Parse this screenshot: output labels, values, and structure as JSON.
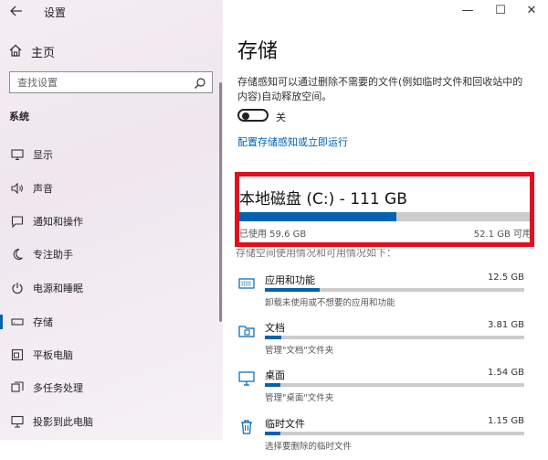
{
  "window": {
    "title": "设置",
    "minimize_glyph": "—",
    "maximize_glyph": "☐",
    "close_glyph": "✕"
  },
  "sidebar": {
    "home_label": "主页",
    "search_placeholder": "查找设置",
    "section_label": "系统",
    "items": [
      {
        "label": "显示",
        "icon": "monitor-icon"
      },
      {
        "label": "声音",
        "icon": "speaker-icon"
      },
      {
        "label": "通知和操作",
        "icon": "notification-icon"
      },
      {
        "label": "专注助手",
        "icon": "moon-icon"
      },
      {
        "label": "电源和睡眠",
        "icon": "power-icon"
      },
      {
        "label": "存储",
        "icon": "storage-icon",
        "active": true
      },
      {
        "label": "平板电脑",
        "icon": "tablet-icon"
      },
      {
        "label": "多任务处理",
        "icon": "multitask-icon"
      },
      {
        "label": "投影到此电脑",
        "icon": "project-icon"
      }
    ]
  },
  "main": {
    "title": "存储",
    "description": "存储感知可以通过删除不需要的文件(例如临时文件和回收站中的内容)自动释放空间。",
    "toggle": {
      "state_label": "关",
      "on": false
    },
    "configure_link": "配置存储感知或立即运行",
    "drive": {
      "title": "本地磁盘 (C:) - 111 GB",
      "used_label": "已使用 59.6 GB",
      "free_label": "52.1 GB 可用",
      "used_fraction": 0.537
    },
    "partial_text": "存储空间使用情况和可用情况如下：",
    "categories": [
      {
        "name": "应用和功能",
        "size": "12.5 GB",
        "desc": "卸载未使用或不想要的应用和功能",
        "fraction": 0.21,
        "icon": "apps-icon"
      },
      {
        "name": "文档",
        "size": "3.81 GB",
        "desc": "管理\"文档\"文件夹",
        "fraction": 0.064,
        "icon": "documents-icon"
      },
      {
        "name": "桌面",
        "size": "1.54 GB",
        "desc": "管理\"桌面\"文件夹",
        "fraction": 0.026,
        "icon": "desktop-icon"
      },
      {
        "name": "临时文件",
        "size": "1.15 GB",
        "desc": "选择要删除的临时文件",
        "fraction": 0.019,
        "icon": "trash-icon"
      }
    ]
  },
  "colors": {
    "accent": "#0063b1",
    "highlight_box": "#e0101e",
    "bar_track": "#cccccc"
  }
}
